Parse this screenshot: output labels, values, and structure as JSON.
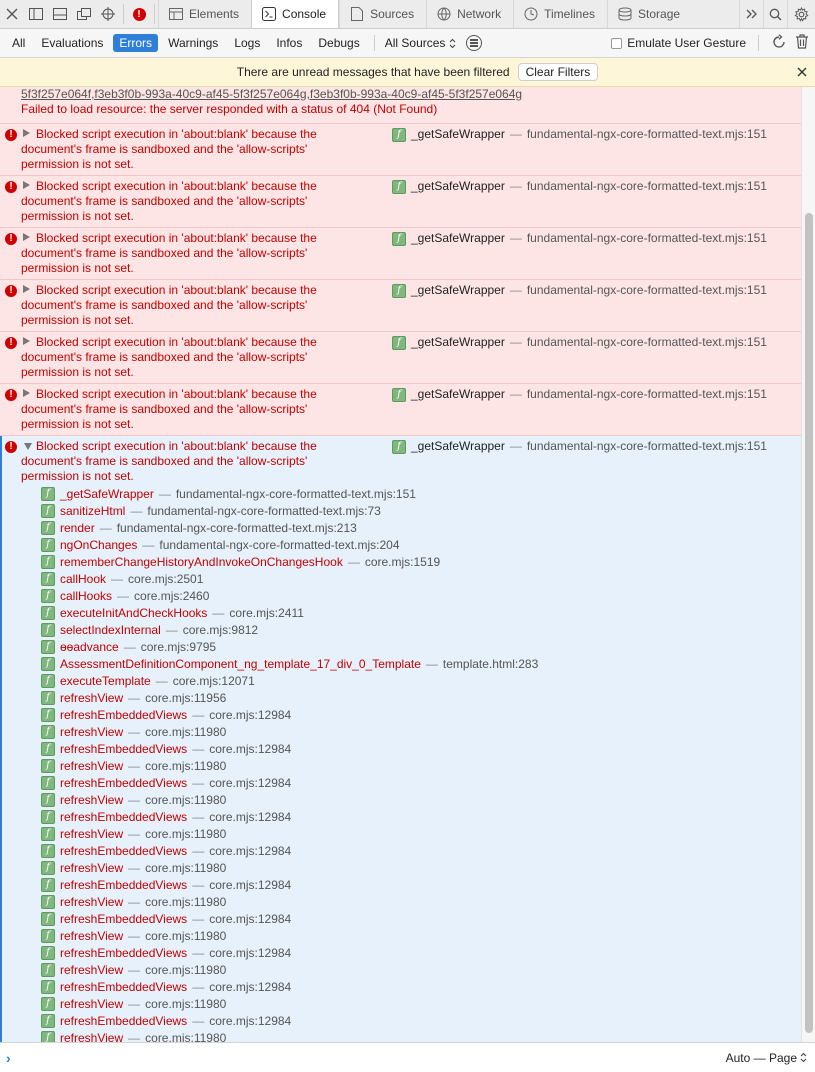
{
  "toolbar": {
    "tabs": [
      {
        "label": "Elements",
        "icon": "elements-icon"
      },
      {
        "label": "Console",
        "icon": "console-icon",
        "active": true
      },
      {
        "label": "Sources",
        "icon": "sources-icon"
      },
      {
        "label": "Network",
        "icon": "network-icon"
      },
      {
        "label": "Timelines",
        "icon": "timelines-icon"
      },
      {
        "label": "Storage",
        "icon": "storage-icon"
      }
    ]
  },
  "filters": {
    "buttons": [
      "All",
      "Evaluations",
      "Errors",
      "Warnings",
      "Logs",
      "Infos",
      "Debugs"
    ],
    "active": "Errors",
    "sources_label": "All Sources",
    "emulate_label": "Emulate User Gesture"
  },
  "banner": {
    "text": "There are unread messages that have been filtered",
    "button": "Clear Filters"
  },
  "top_message": {
    "link": "5f3f257e064f,f3eb3f0b-993a-40c9-af45-5f3f257e064g,f3eb3f0b-993a-40c9-af45-5f3f257e064g",
    "text": "Failed to load resource: the server responded with a status of 404 (Not Found)"
  },
  "error_message": {
    "line1": "Blocked script execution in 'about:blank' because the",
    "line2": "document's frame is sandboxed and the 'allow-scripts'",
    "line3": "permission is not set.",
    "function": "_getSafeWrapper",
    "location": "fundamental-ngx-core-formatted-text.mjs:151"
  },
  "collapsed_count": 6,
  "stack_frames": [
    {
      "fn": "_getSafeWrapper",
      "loc": "fundamental-ngx-core-formatted-text.mjs:151"
    },
    {
      "fn": "sanitizeHtml",
      "loc": "fundamental-ngx-core-formatted-text.mjs:73"
    },
    {
      "fn": "render",
      "loc": "fundamental-ngx-core-formatted-text.mjs:213"
    },
    {
      "fn": "ngOnChanges",
      "loc": "fundamental-ngx-core-formatted-text.mjs:204"
    },
    {
      "fn": "rememberChangeHistoryAndInvokeOnChangesHook",
      "loc": "core.mjs:1519"
    },
    {
      "fn": "callHook",
      "loc": "core.mjs:2501"
    },
    {
      "fn": "callHooks",
      "loc": "core.mjs:2460"
    },
    {
      "fn": "executeInitAndCheckHooks",
      "loc": "core.mjs:2411"
    },
    {
      "fn": "selectIndexInternal",
      "loc": "core.mjs:9812"
    },
    {
      "fn": "ɵɵadvance",
      "loc": "core.mjs:9795"
    },
    {
      "fn": "AssessmentDefinitionComponent_ng_template_17_div_0_Template",
      "loc": "template.html:283"
    },
    {
      "fn": "executeTemplate",
      "loc": "core.mjs:12071"
    },
    {
      "fn": "refreshView",
      "loc": "core.mjs:11956"
    },
    {
      "fn": "refreshEmbeddedViews",
      "loc": "core.mjs:12984"
    },
    {
      "fn": "refreshView",
      "loc": "core.mjs:11980"
    },
    {
      "fn": "refreshEmbeddedViews",
      "loc": "core.mjs:12984"
    },
    {
      "fn": "refreshView",
      "loc": "core.mjs:11980"
    },
    {
      "fn": "refreshEmbeddedViews",
      "loc": "core.mjs:12984"
    },
    {
      "fn": "refreshView",
      "loc": "core.mjs:11980"
    },
    {
      "fn": "refreshEmbeddedViews",
      "loc": "core.mjs:12984"
    },
    {
      "fn": "refreshView",
      "loc": "core.mjs:11980"
    },
    {
      "fn": "refreshEmbeddedViews",
      "loc": "core.mjs:12984"
    },
    {
      "fn": "refreshView",
      "loc": "core.mjs:11980"
    },
    {
      "fn": "refreshEmbeddedViews",
      "loc": "core.mjs:12984"
    },
    {
      "fn": "refreshView",
      "loc": "core.mjs:11980"
    },
    {
      "fn": "refreshEmbeddedViews",
      "loc": "core.mjs:12984"
    },
    {
      "fn": "refreshView",
      "loc": "core.mjs:11980"
    },
    {
      "fn": "refreshEmbeddedViews",
      "loc": "core.mjs:12984"
    },
    {
      "fn": "refreshView",
      "loc": "core.mjs:11980"
    },
    {
      "fn": "refreshEmbeddedViews",
      "loc": "core.mjs:12984"
    },
    {
      "fn": "refreshView",
      "loc": "core.mjs:11980"
    },
    {
      "fn": "refreshEmbeddedViews",
      "loc": "core.mjs:12984"
    },
    {
      "fn": "refreshView",
      "loc": "core.mjs:11980"
    }
  ],
  "prompt": {
    "mode_label": "Auto — Page"
  },
  "colors": {
    "error_text": "#c50000",
    "error_bg": "#fde5e5",
    "selected_bg": "#e6f1fb",
    "accent": "#2f7fd8"
  }
}
